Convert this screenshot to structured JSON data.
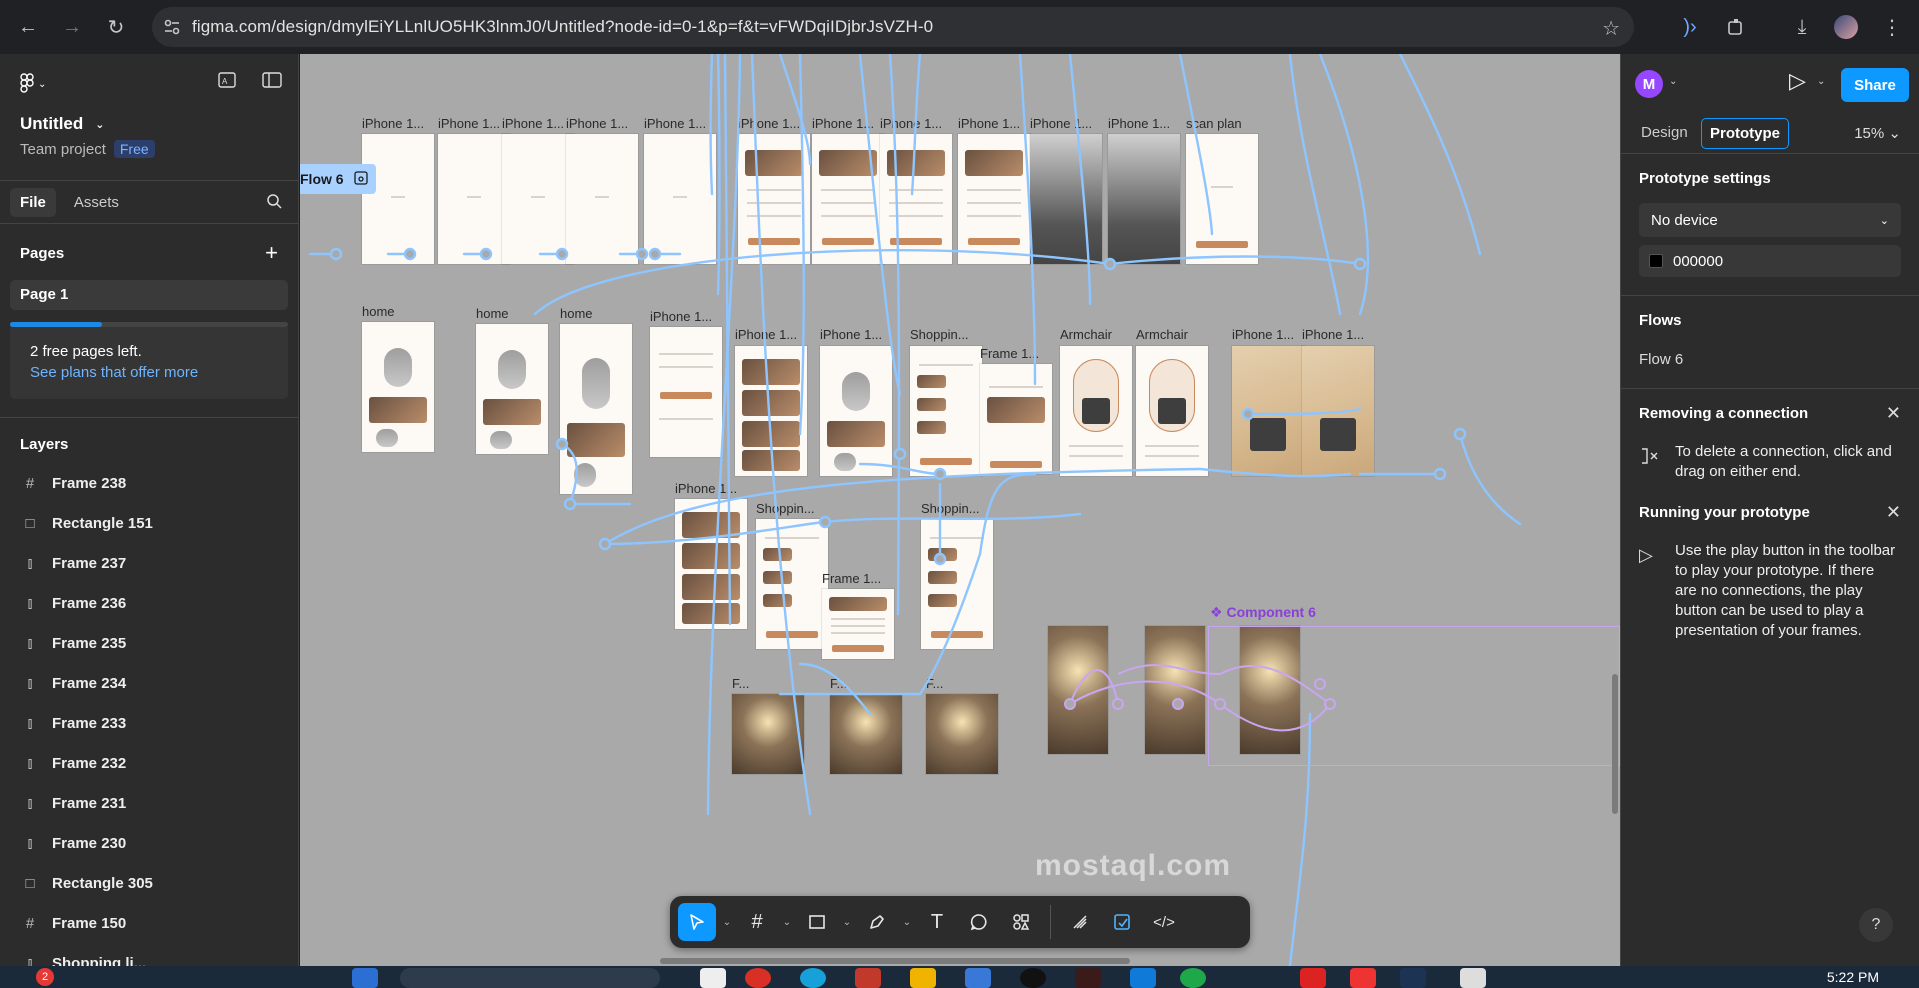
{
  "browser": {
    "url": "figma.com/design/dmylEiYLLnlUO5HK3lnmJ0/Untitled?node-id=0-1&p=f&t=vFWDqiIDjbrJsVZH-0"
  },
  "file": {
    "title": "Untitled",
    "project": "Team project",
    "plan_badge": "Free"
  },
  "left_tabs": [
    "File",
    "Assets"
  ],
  "pages": {
    "heading": "Pages",
    "items": [
      "Page 1"
    ],
    "used_fraction": 0.33,
    "notice": "2 free pages left.",
    "notice_link": "See plans that offer more"
  },
  "layers": {
    "heading": "Layers",
    "items": [
      {
        "name": "Frame 238",
        "icon": "hash-frame-icon"
      },
      {
        "name": "Rectangle 151",
        "icon": "rectangle-icon"
      },
      {
        "name": "Frame 237",
        "icon": "auto-layout-icon"
      },
      {
        "name": "Frame 236",
        "icon": "auto-layout-icon"
      },
      {
        "name": "Frame 235",
        "icon": "auto-layout-icon"
      },
      {
        "name": "Frame 234",
        "icon": "auto-layout-icon"
      },
      {
        "name": "Frame 233",
        "icon": "auto-layout-icon"
      },
      {
        "name": "Frame 232",
        "icon": "auto-layout-icon"
      },
      {
        "name": "Frame 231",
        "icon": "auto-layout-icon"
      },
      {
        "name": "Frame 230",
        "icon": "auto-layout-icon"
      },
      {
        "name": "Rectangle 305",
        "icon": "rectangle-icon"
      },
      {
        "name": "Frame 150",
        "icon": "hash-frame-icon"
      },
      {
        "name": "Shopping li...",
        "icon": "auto-layout-icon"
      }
    ]
  },
  "canvas": {
    "flow_tag": "Flow 6",
    "component_label": "Component 6",
    "frame_labels": {
      "r1": [
        "iPhone 1...",
        "iPhone 1...",
        "iPhone 1...",
        "iPhone 1...",
        "iPhone 1...",
        "iPhone 1...",
        "iPhone 1...",
        "iPhone 1...",
        "iPhone 1...",
        "iPhone 1...",
        "iPhone 1...",
        "scan plan"
      ],
      "r2": [
        "home",
        "home",
        "home",
        "iPhone 1...",
        "iPhone 1...",
        "iPhone 1...",
        "Shoppin...",
        "Frame 1...",
        "Armchair",
        "Armchair",
        "iPhone 1...",
        "iPhone 1..."
      ],
      "r3": [
        "iPhone 1...",
        "Shoppin...",
        "Frame 1...",
        "Shoppin..."
      ],
      "r4": [
        "F...",
        "F...",
        "F..."
      ]
    },
    "watermark": "mostaql.com"
  },
  "toolbar": {
    "tools": [
      "move-tool",
      "frame-tool",
      "rectangle-tool",
      "pen-tool",
      "text-tool",
      "comment-tool",
      "actions-tool",
      "draw-mode",
      "design-mode",
      "dev-mode"
    ],
    "active": "move-tool"
  },
  "right_panel": {
    "avatar_letter": "M",
    "share_label": "Share",
    "tabs": [
      "Design",
      "Prototype"
    ],
    "active_tab": "Prototype",
    "zoom": "15%",
    "prototype_settings": {
      "heading": "Prototype settings",
      "device": "No device",
      "background_hex": "000000"
    },
    "flows": {
      "heading": "Flows",
      "items": [
        "Flow 6"
      ]
    },
    "removing": {
      "heading": "Removing a connection",
      "text": "To delete a connection, click and drag on either end."
    },
    "running": {
      "heading": "Running your prototype",
      "text": "Use the play button in the toolbar to play your prototype. If there are no connections, the play button can be used to play a presentation of your frames."
    },
    "help": "?"
  },
  "taskbar": {
    "notification_count": "2",
    "time": "5:22 PM"
  },
  "colors": {
    "accent": "#0d99ff",
    "connector": "#8ec5ff",
    "component": "#8b3fd9",
    "canvas_bg": "#a9a9a9",
    "panel_bg": "#2c2c2c"
  }
}
